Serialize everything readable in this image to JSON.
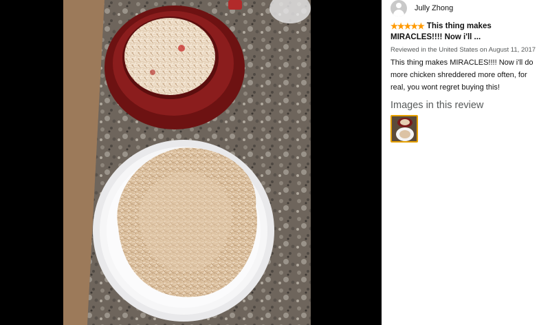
{
  "review": {
    "author": "Jully Zhong",
    "rating_stars": "★★★★★",
    "rating": 5,
    "title": "This thing makes MIRACLES!!!! Now i'll ...",
    "meta": "Reviewed in the United States on August 11, 2017",
    "body": "This thing makes MIRACLES!!!! Now i'll do more chicken shreddered more often, for real, you wont regret buying this!",
    "images_heading": "Images in this review"
  },
  "colors": {
    "star": "#ff9900",
    "thumb_border": "#e6a000",
    "meta_text": "#565959"
  },
  "icons": {
    "avatar": "user-avatar-icon",
    "stars": "star-icon"
  }
}
